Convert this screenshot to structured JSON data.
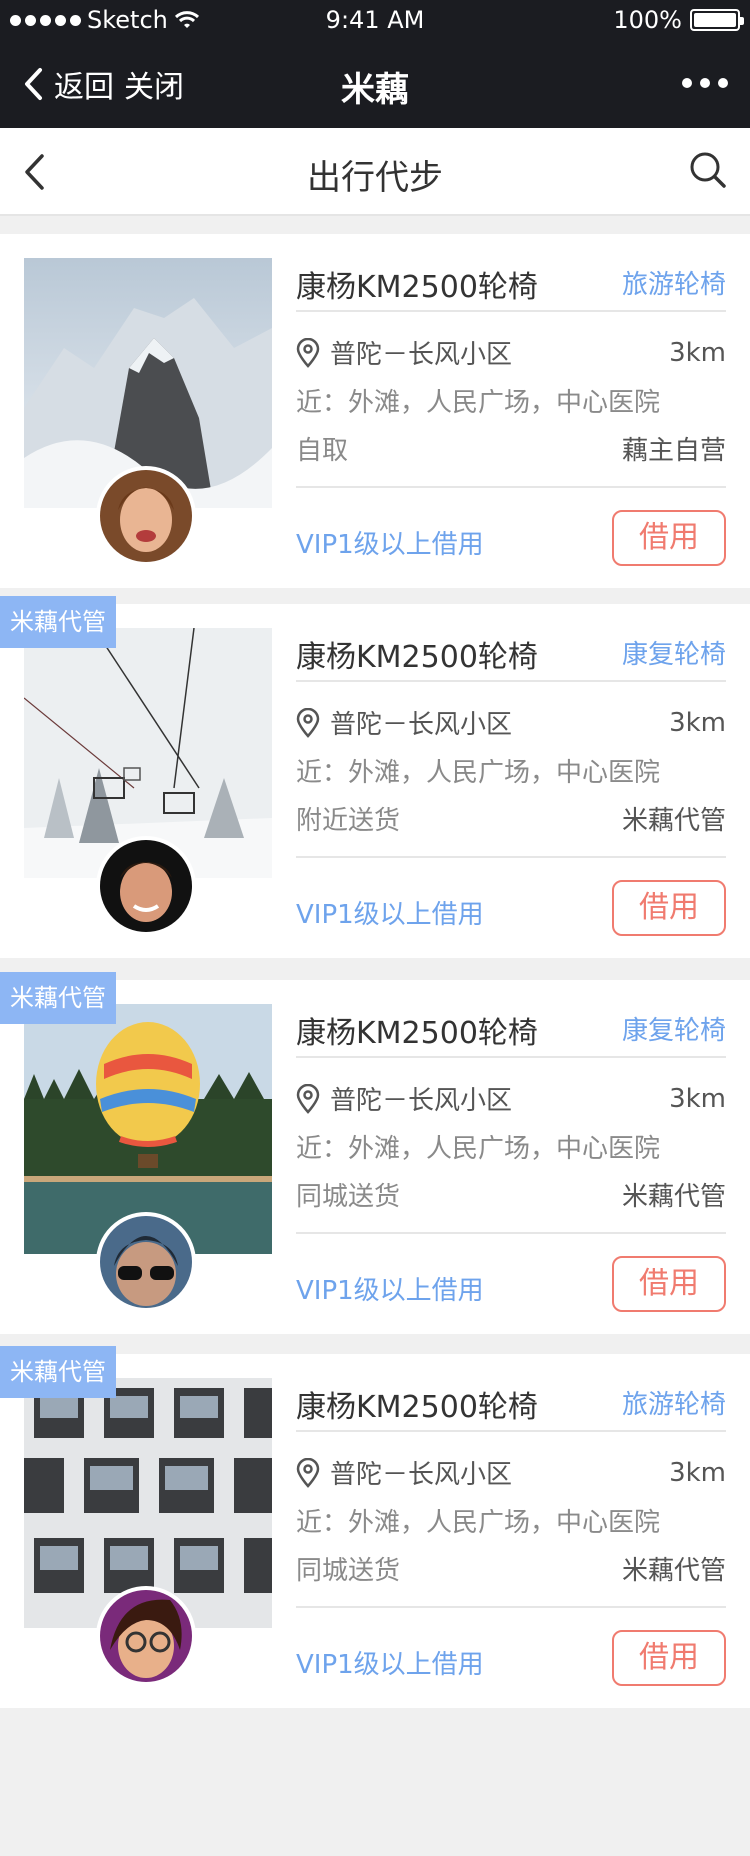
{
  "status_bar": {
    "carrier": "Sketch",
    "time": "9:41 AM",
    "battery": "100%"
  },
  "wechat_nav": {
    "back_label": "返回",
    "close_label": "关闭",
    "title": "米藕"
  },
  "page": {
    "title": "出行代步"
  },
  "items": [
    {
      "name": "康杨KM2500轮椅",
      "category": "旅游轮椅",
      "location": "普陀－长风小区",
      "distance": "3km",
      "nearby": "近：外滩，人民广场，中心医院",
      "delivery": "自取",
      "owner_type": "藕主自营",
      "vip_text": "VIP1级以上借用",
      "borrow_label": "借用",
      "tag": ""
    },
    {
      "name": "康杨KM2500轮椅",
      "category": "康复轮椅",
      "location": "普陀－长风小区",
      "distance": "3km",
      "nearby": "近：外滩，人民广场，中心医院",
      "delivery": "附近送货",
      "owner_type": "米藕代管",
      "vip_text": "VIP1级以上借用",
      "borrow_label": "借用",
      "tag": "米藕代管"
    },
    {
      "name": "康杨KM2500轮椅",
      "category": "康复轮椅",
      "location": "普陀－长风小区",
      "distance": "3km",
      "nearby": "近：外滩，人民广场，中心医院",
      "delivery": "同城送货",
      "owner_type": "米藕代管",
      "vip_text": "VIP1级以上借用",
      "borrow_label": "借用",
      "tag": "米藕代管"
    },
    {
      "name": "康杨KM2500轮椅",
      "category": "旅游轮椅",
      "location": "普陀－长风小区",
      "distance": "3km",
      "nearby": "近：外滩，人民广场，中心医院",
      "delivery": "同城送货",
      "owner_type": "米藕代管",
      "vip_text": "VIP1级以上借用",
      "borrow_label": "借用",
      "tag": "米藕代管"
    }
  ],
  "colors": {
    "accent_blue": "#6ea3ec",
    "tag_blue": "#8db6f4",
    "borrow_red": "#f07b6f",
    "nav_dark": "#1b1c21"
  }
}
